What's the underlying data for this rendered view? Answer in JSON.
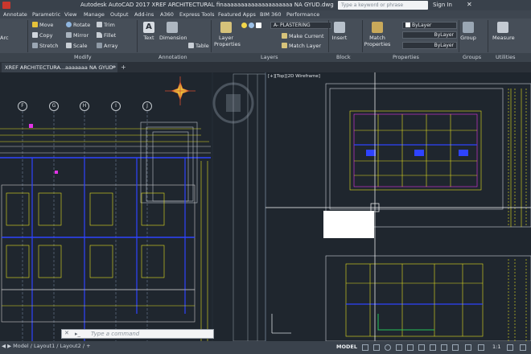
{
  "window": {
    "title": "Autodesk AutoCAD 2017   XREF ARCHITECTURAL finaaaaaaaaaaaaaaaaaaaa NA GYUD.dwg",
    "search_placeholder": "Type a keyword or phrase",
    "user_label": "Sign In",
    "close_glyph": "✕"
  },
  "menu": [
    "Annotate",
    "Parametric",
    "View",
    "Manage",
    "Output",
    "Add-ins",
    "A360",
    "Express Tools",
    "Featured Apps",
    "BIM 360",
    "Performance"
  ],
  "ribbon": {
    "draw_label": "Arc",
    "modify": {
      "move": "Move",
      "rotate": "Rotate",
      "trim": "Trim",
      "copy": "Copy",
      "mirror": "Mirror",
      "fillet": "Fillet",
      "stretch": "Stretch",
      "scale": "Scale",
      "array": "Array"
    },
    "annotation": {
      "text": "Text",
      "dimension": "Dimension",
      "table": "Table"
    },
    "layers": {
      "layer_properties": "Layer Properties",
      "current_layer": "A- PLASTERING",
      "make_current": "Make Current",
      "match_layer": "Match Layer"
    },
    "block": {
      "insert": "Insert"
    },
    "properties": {
      "match_properties": "Match Properties",
      "color": "ByLayer",
      "linetype": "ByLayer",
      "lineweight": "ByLayer"
    },
    "groups": {
      "group": "Group"
    },
    "utilities": {
      "measure": "Measure"
    },
    "panels": [
      "Modify",
      "Annotation",
      "Layers",
      "Block",
      "Properties",
      "Groups",
      "Utilities"
    ]
  },
  "file_tab": {
    "label": "XREF ARCHITECTURA...aaaaaaa NA GYUD*",
    "close_glyph": "×",
    "new_tab_glyph": "+"
  },
  "viewport": {
    "label": "[+][Top][2D Wireframe]",
    "column_grid": [
      "F",
      "G",
      "H",
      "I",
      "J"
    ]
  },
  "command_line": {
    "placeholder": "Type a command",
    "close_glyph": "✕"
  },
  "status": {
    "layout_tabs": "◀ ▶  Model  /  Layout1  /  Layout2  /  +",
    "mode": "MODEL",
    "scale": "1:1"
  },
  "colors": {
    "canvas": "#1f262e",
    "ribbon": "#464e58",
    "drawing_yellow": "#e6e01f",
    "drawing_blue": "#2e43ff",
    "drawing_magenta": "#e233e6",
    "crosshair": "#ffffff"
  }
}
